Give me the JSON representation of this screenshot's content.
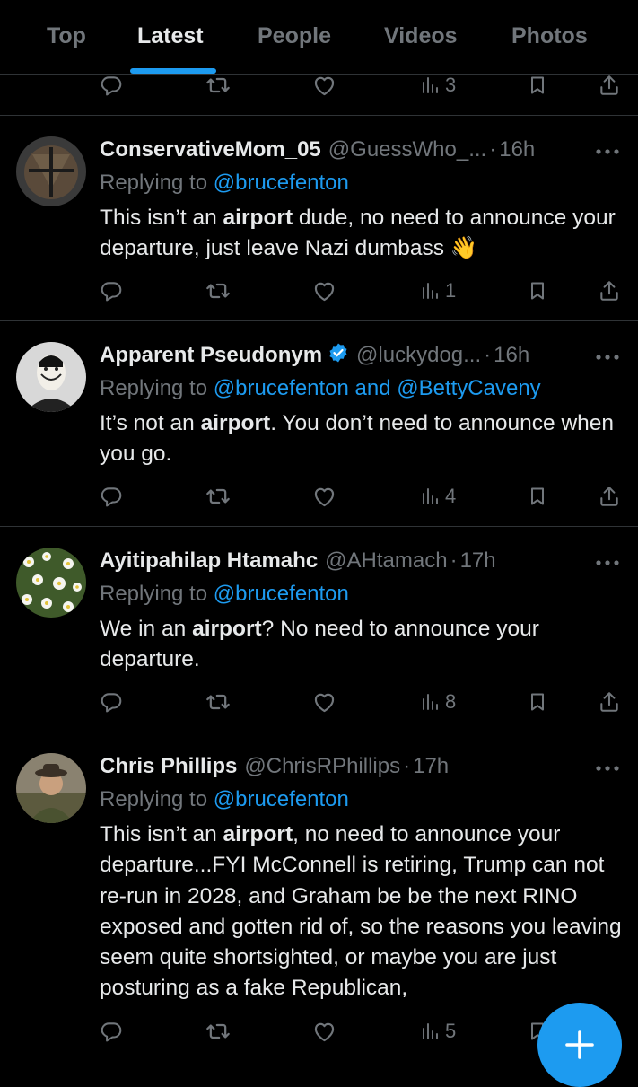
{
  "tabs": [
    "Top",
    "Latest",
    "People",
    "Videos",
    "Photos"
  ],
  "prev_tweet_views": "3",
  "tweets": [
    {
      "name": "ConservativeMom_05",
      "handle": "@GuessWho_...",
      "time": "16h",
      "replying_prefix": "Replying to ",
      "replying_to": "@brucefenton",
      "body_pre": "This isn’t an ",
      "body_bold": "airport",
      "body_post": " dude, no need to announce your departure, just leave Nazi dumbass 👋",
      "views": "1"
    },
    {
      "name": "Apparent Pseudonym",
      "handle": "@luckydog...",
      "time": "16h",
      "replying_prefix": "Replying to ",
      "replying_to": "@brucefenton and @BettyCaveny",
      "body_pre": "It’s not an ",
      "body_bold": "airport",
      "body_post": ". You don’t need to announce when you go.",
      "views": "4"
    },
    {
      "name": "Ayitipahilap Htamahc",
      "handle": "@AHtamach",
      "time": "17h",
      "replying_prefix": "Replying to ",
      "replying_to": "@brucefenton",
      "body_pre": "We in an ",
      "body_bold": "airport",
      "body_post": "? No need to announce your departure.",
      "views": "8"
    },
    {
      "name": "Chris Phillips",
      "handle": "@ChrisRPhillips",
      "time": "17h",
      "replying_prefix": "Replying to ",
      "replying_to": "@brucefenton",
      "body_pre": "This isn’t an ",
      "body_bold": "airport",
      "body_post": ", no need to announce your departure...FYI McConnell is retiring, Trump can not re-run in 2028, and Graham be be the next RINO exposed and gotten rid of, so the reasons you leaving seem quite shortsighted, or maybe you are just posturing as a fake Republican,",
      "views": "5"
    }
  ],
  "dot_sep": "·",
  "icons": {
    "reply": "reply-icon",
    "retweet": "retweet-icon",
    "like": "heart-icon",
    "views": "views-icon",
    "bookmark": "bookmark-icon",
    "share": "share-icon",
    "more": "more-icon",
    "verified": "verified-badge-icon",
    "compose": "plus-icon"
  },
  "colors": {
    "background": "#000000",
    "accent": "#1d9bf0",
    "text": "#e7e9ea",
    "muted": "#71767b",
    "divider": "#2f3336"
  }
}
